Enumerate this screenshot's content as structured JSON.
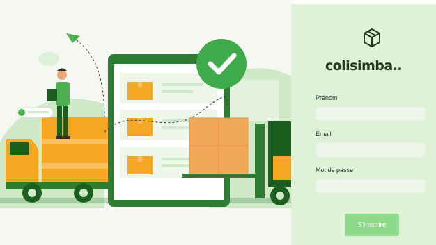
{
  "brand": {
    "name": "colisimba..",
    "icon": "package-box-icon"
  },
  "form": {
    "first_name_label": "Prénom",
    "first_name_value": "",
    "email_label": "Email",
    "email_value": "",
    "password_label": "Mot de passe",
    "password_value": "",
    "submit_label": "S'inscrire"
  },
  "colors": {
    "panel_background": "#dff2d8",
    "button": "#8fd98a",
    "brand_text": "#1f3a1c",
    "accent_green": "#2f7d32",
    "truck_orange": "#f5a623"
  }
}
